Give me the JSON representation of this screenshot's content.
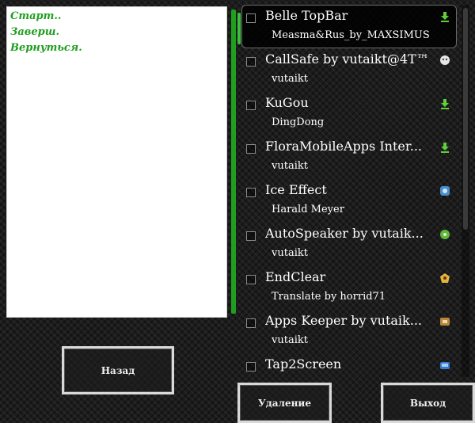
{
  "log": {
    "lines": [
      "Старт..",
      "Заверш.",
      "Вернуться."
    ]
  },
  "buttons": {
    "back": "Назад",
    "delete": "Удаление",
    "exit": "Выход"
  },
  "apps": [
    {
      "name": "Belle TopBar",
      "author": "Measma&Rus_by_MAXSIMUS",
      "icon": "download-icon",
      "selected": true
    },
    {
      "name": "CallSafe by vutaikt@4T™",
      "author": "vutaikt",
      "icon": "app-icon"
    },
    {
      "name": "KuGou",
      "author": "DingDong",
      "icon": "download-icon"
    },
    {
      "name": "FloraMobileApps Inter...",
      "author": "vutaikt",
      "icon": "download-icon"
    },
    {
      "name": "Ice Effect",
      "author": "Harald Meyer",
      "icon": "app-icon"
    },
    {
      "name": "AutoSpeaker by vutaik...",
      "author": "vutaikt",
      "icon": "app-icon"
    },
    {
      "name": "EndClear",
      "author": "Translate by horrid71",
      "icon": "app-icon"
    },
    {
      "name": "Apps Keeper by vutaik...",
      "author": "vutaikt",
      "icon": "app-icon"
    },
    {
      "name": "Tap2Screen",
      "author": "",
      "icon": "app-icon"
    }
  ],
  "colors": {
    "accent": "#1e9e1e",
    "background": "#1c1c1c"
  }
}
